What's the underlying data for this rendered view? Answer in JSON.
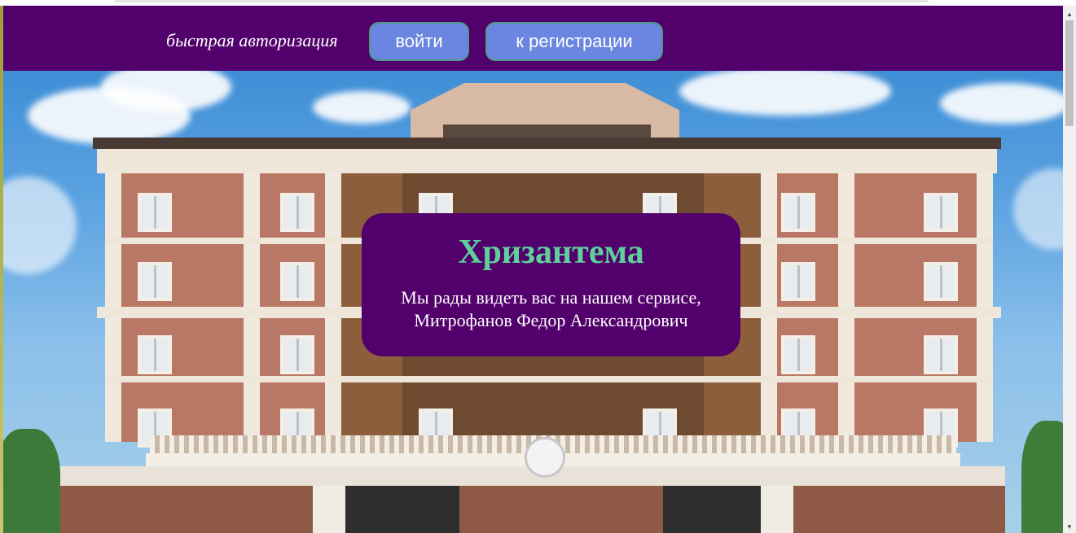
{
  "header": {
    "quick_auth_label": "быстрая авторизация",
    "login_button": "войти",
    "register_button": "к регистрации",
    "background_color": "#52006b",
    "button_color": "#6b86e0"
  },
  "hero": {
    "image_subject": "hotel-building-photo",
    "card": {
      "title": "Хризантема",
      "line1": "Мы рады видеть вас на нашем сервисе,",
      "line2": "Митрофанов Федор Александрович",
      "title_color": "#5fcf9c",
      "background_color": "#52006b"
    }
  },
  "scrollbar": {
    "up_icon": "triangle-up-icon",
    "down_icon": "triangle-down-icon"
  }
}
